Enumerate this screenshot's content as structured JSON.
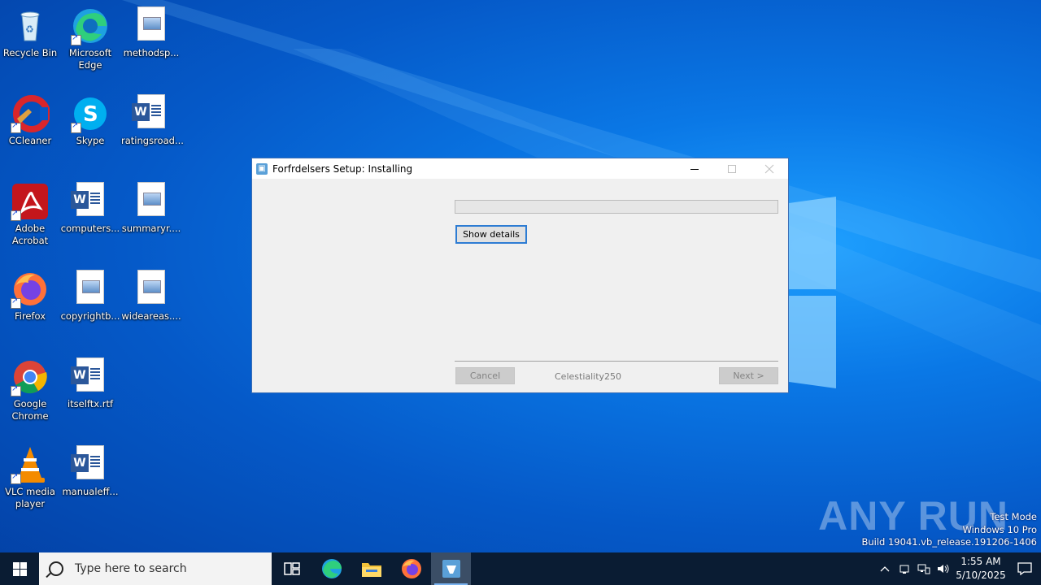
{
  "desktop": {
    "icons": [
      {
        "label": "Recycle Bin"
      },
      {
        "label": "Microsoft Edge"
      },
      {
        "label": "methodsp..."
      },
      {
        "label": "CCleaner"
      },
      {
        "label": "Skype"
      },
      {
        "label": "ratingsroad..."
      },
      {
        "label": "Adobe Acrobat"
      },
      {
        "label": "computers..."
      },
      {
        "label": "summaryr...."
      },
      {
        "label": "Firefox"
      },
      {
        "label": "copyrightb..."
      },
      {
        "label": "wideareas...."
      },
      {
        "label": "Google Chrome"
      },
      {
        "label": "itselftx.rtf"
      },
      {
        "label": "VLC media player"
      },
      {
        "label": "manualeff..."
      }
    ]
  },
  "setup_window": {
    "title": "Forfrdelsers Setup: Installing",
    "progress_percent": 0,
    "show_details_label": "Show details",
    "cancel_label": "Cancel",
    "brand_text": "Celestiality250",
    "next_label": "Next >"
  },
  "watermark": {
    "logo_text": "ANY RUN",
    "mode": "Test Mode",
    "edition": "Windows 10 Pro",
    "build": "Build 19041.vb_release.191206-1406"
  },
  "taskbar": {
    "search_placeholder": "Type here to search",
    "clock_time": "1:55 AM",
    "clock_date": "5/10/2025"
  },
  "colors": {
    "accent": "#2d7cd3",
    "taskbar_bg": "#0a1c33",
    "desktop_blue": "#0a78e6"
  }
}
